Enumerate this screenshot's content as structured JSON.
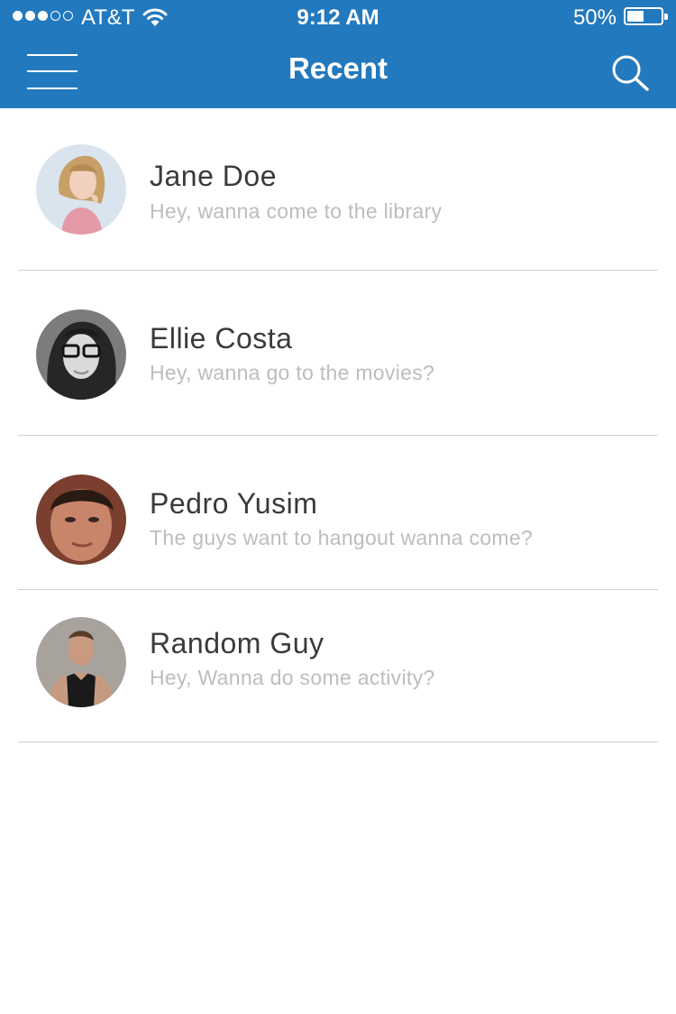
{
  "status_bar": {
    "carrier": "AT&T",
    "time": "9:12 AM",
    "battery_percent": "50%",
    "battery_level": 0.5,
    "signal_bars_filled": 3,
    "signal_bars_total": 5
  },
  "header": {
    "title": "Recent",
    "menu_icon": "hamburger-menu-icon",
    "search_icon": "search-icon",
    "background_color": "#2379bd"
  },
  "conversations": [
    {
      "name": "Jane Doe",
      "message": "Hey, wanna come to the library"
    },
    {
      "name": "Ellie Costa",
      "message": "Hey, wanna go to the movies?"
    },
    {
      "name": "Pedro Yusim",
      "message": "The guys want to hangout wanna come?"
    },
    {
      "name": "Random Guy",
      "message": "Hey, Wanna do some activity?"
    }
  ]
}
